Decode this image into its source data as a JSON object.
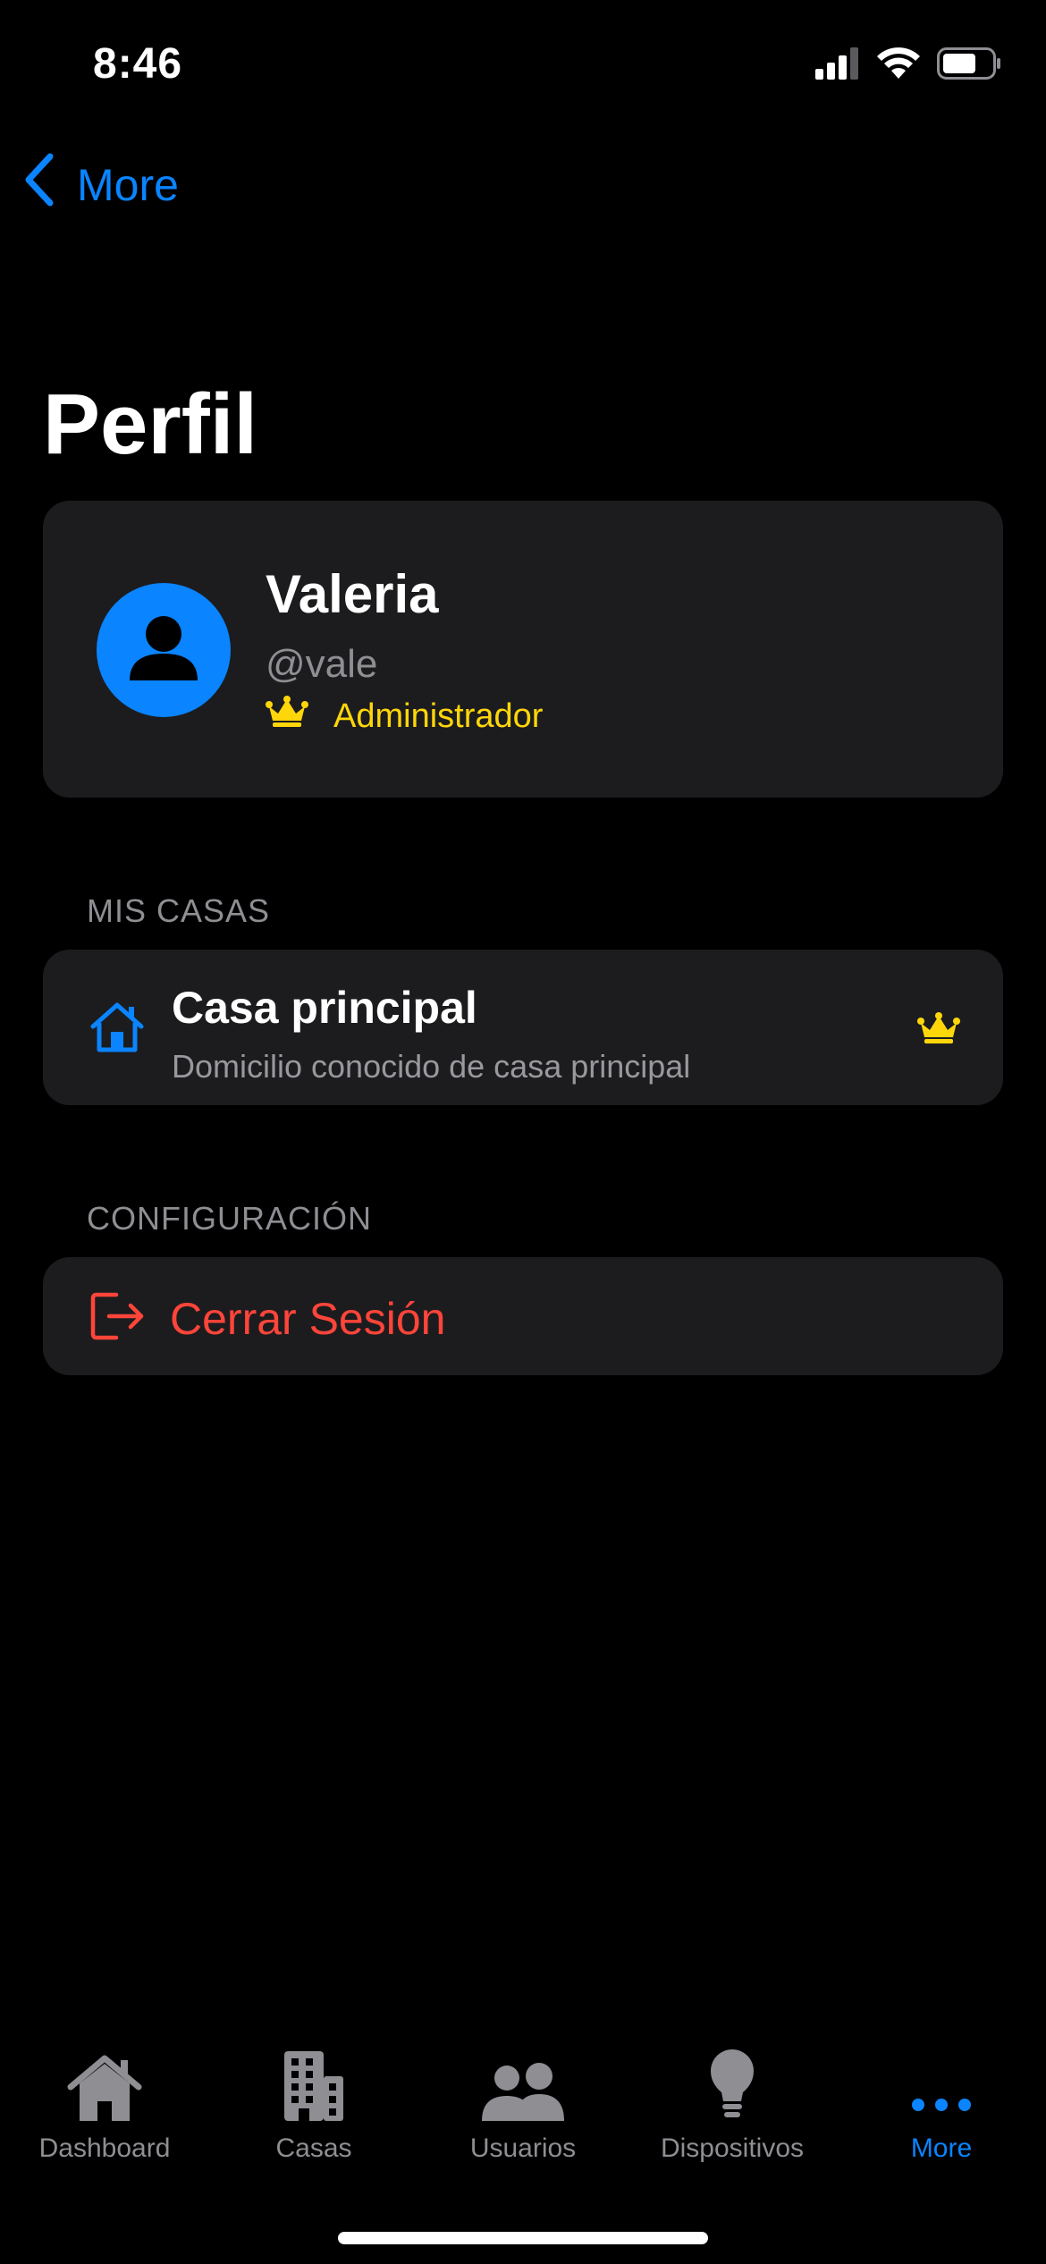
{
  "status_bar": {
    "time": "8:46",
    "icons": [
      "cellular-signal-icon",
      "wifi-icon",
      "battery-icon"
    ]
  },
  "nav": {
    "back_label": "More",
    "back_icon": "chevron-left-icon"
  },
  "page": {
    "title": "Perfil"
  },
  "profile": {
    "name": "Valeria",
    "handle": "@vale",
    "role": "Administrador",
    "role_icon": "crown-icon",
    "avatar_icon": "person-icon"
  },
  "sections": {
    "houses_header": "MIS CASAS",
    "config_header": "CONFIGURACIÓN"
  },
  "houses": [
    {
      "name": "Casa principal",
      "address": "Domicilio conocido de casa principal",
      "icon": "house-icon",
      "badge_icon": "crown-icon"
    }
  ],
  "config": {
    "logout_label": "Cerrar Sesión",
    "logout_icon": "logout-icon"
  },
  "tab_bar": {
    "tabs": [
      {
        "label": "Dashboard",
        "icon": "house-fill-icon",
        "active": false
      },
      {
        "label": "Casas",
        "icon": "building-icon",
        "active": false
      },
      {
        "label": "Usuarios",
        "icon": "people-icon",
        "active": false
      },
      {
        "label": "Dispositivos",
        "icon": "lightbulb-icon",
        "active": false
      },
      {
        "label": "More",
        "icon": "ellipsis-icon",
        "active": true
      }
    ]
  },
  "colors": {
    "background": "#000000",
    "card": "#1c1c1e",
    "accent": "#0a84ff",
    "admin": "#ffd60a",
    "destructive": "#ff453a",
    "secondary_text": "#8e8e93"
  }
}
